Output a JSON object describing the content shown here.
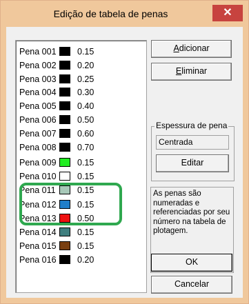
{
  "window": {
    "title": "Edição de tabela de penas",
    "close_symbol": "✕"
  },
  "pens": [
    {
      "name": "Pena 001",
      "color": "#000000",
      "width": "0.15"
    },
    {
      "name": "Pena 002",
      "color": "#000000",
      "width": "0.20"
    },
    {
      "name": "Pena 003",
      "color": "#000000",
      "width": "0.25"
    },
    {
      "name": "Pena 004",
      "color": "#000000",
      "width": "0.30"
    },
    {
      "name": "Pena 005",
      "color": "#000000",
      "width": "0.40"
    },
    {
      "name": "Pena 006",
      "color": "#000000",
      "width": "0.50"
    },
    {
      "name": "Pena 007",
      "color": "#000000",
      "width": "0.60"
    },
    {
      "name": "Pena 008",
      "color": "#000000",
      "width": "0.70"
    },
    {
      "name": "Pena 009",
      "color": "#22ee22",
      "width": "0.15"
    },
    {
      "name": "Pena 010",
      "color": "#ffffff",
      "width": "0.15"
    },
    {
      "name": "Pena 011",
      "color": "#a8c8b8",
      "width": "0.15"
    },
    {
      "name": "Pena 012",
      "color": "#1f7fc9",
      "width": "0.15"
    },
    {
      "name": "Pena 013",
      "color": "#ee1111",
      "width": "0.50"
    },
    {
      "name": "Pena 014",
      "color": "#3f7f7f",
      "width": "0.15"
    },
    {
      "name": "Pena 015",
      "color": "#7a3f10",
      "width": "0.15"
    },
    {
      "name": "Pena 016",
      "color": "#000000",
      "width": "0.20"
    }
  ],
  "buttons": {
    "add_first": "A",
    "add_rest": "dicionar",
    "delete_first": "E",
    "delete_rest": "liminar",
    "edit": "Editar",
    "ok": "OK",
    "cancel": "Cancelar"
  },
  "thickness_group": {
    "label": "Espessura de pena",
    "value": "Centrada"
  },
  "info_text": "As penas são numeradas e referenciadas por seu número na tabela de plotagem.",
  "colors": {
    "titlebar": "#f0c89c",
    "close_button": "#c7433f",
    "highlight": "#2fa84f"
  }
}
